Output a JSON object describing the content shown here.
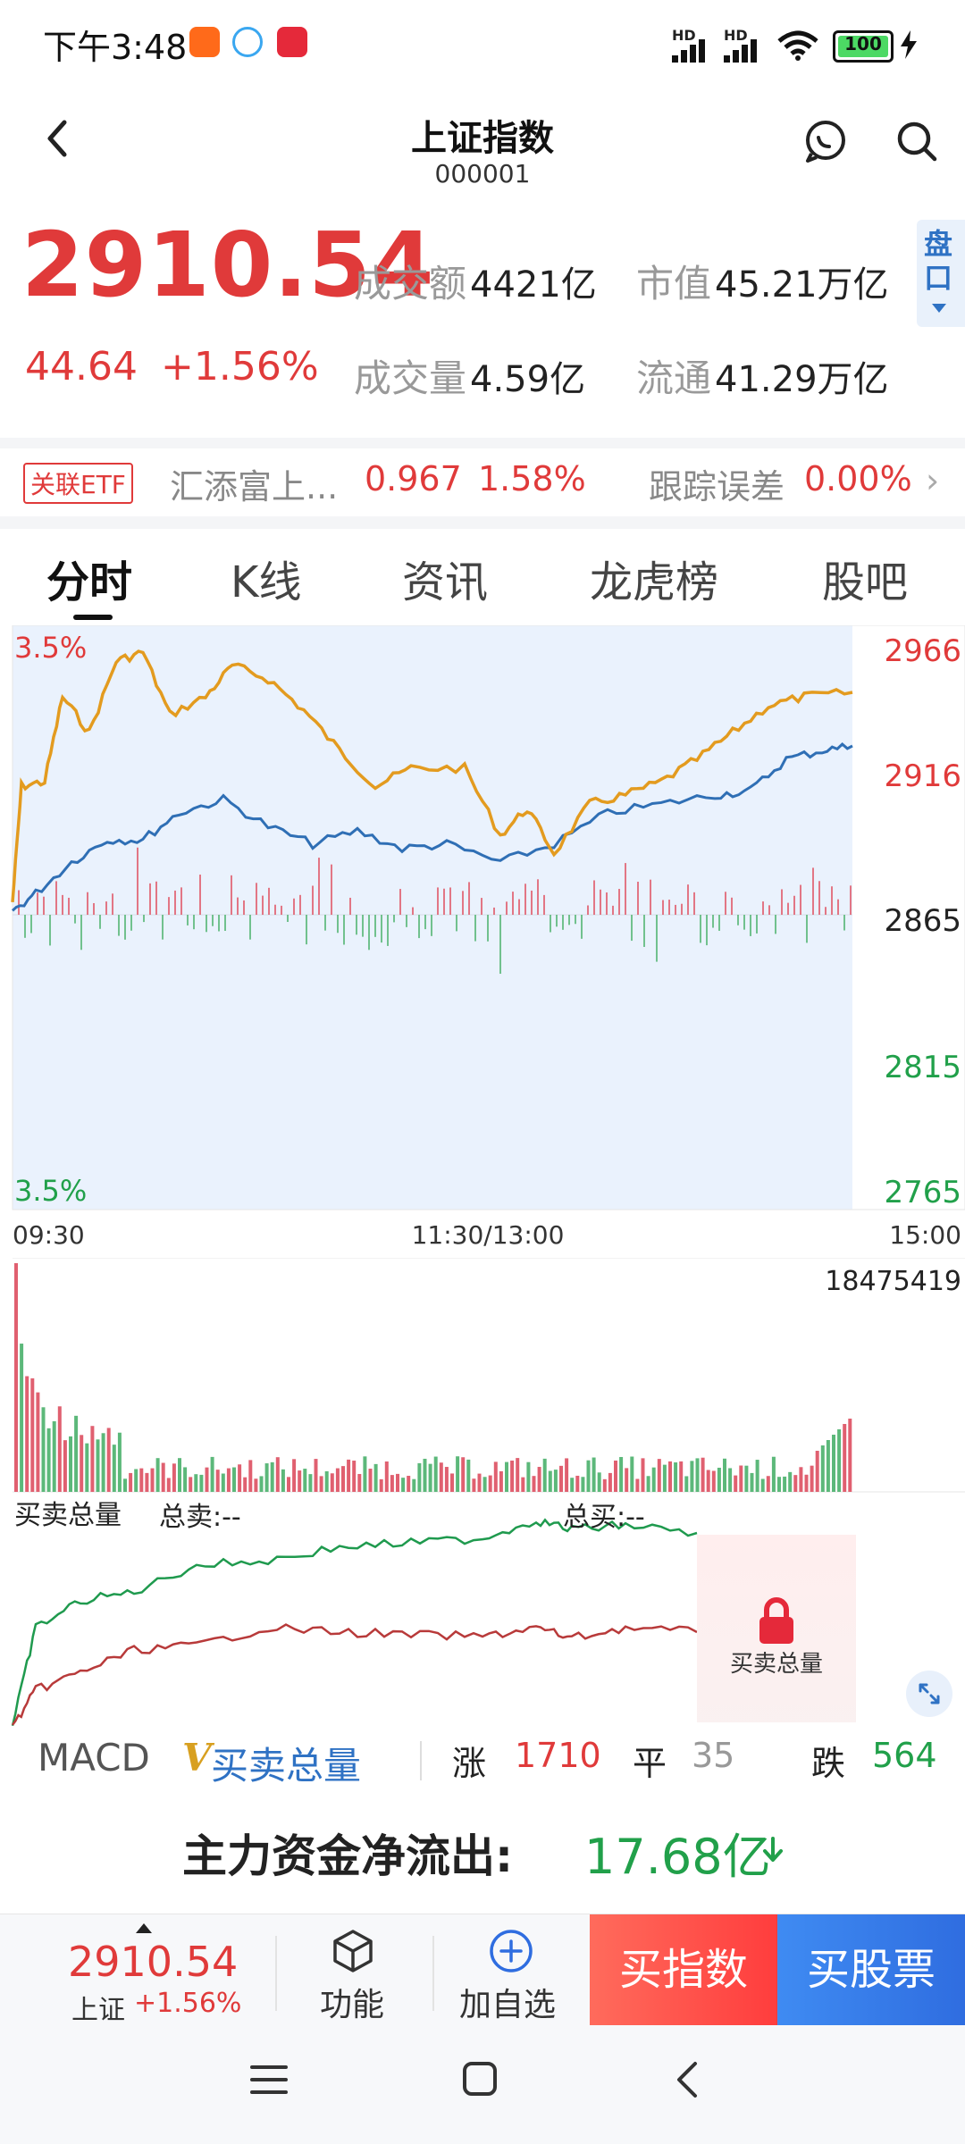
{
  "status_bar": {
    "time": "下午3:48",
    "signal_1": "HD",
    "signal_2": "HD",
    "battery": "100"
  },
  "header": {
    "title": "上证指数",
    "code": "000001"
  },
  "quote": {
    "price": "2910.54",
    "change": "44.64",
    "change_pct": "+1.56%",
    "turnover_label": "成交额",
    "turnover_value": "4421亿",
    "market_cap_label": "市值",
    "market_cap_value": "45.21万亿",
    "volume_label": "成交量",
    "volume_value": "4.59亿",
    "float_label": "流通",
    "float_value": "41.29万亿",
    "side_tab": "盘口"
  },
  "etf": {
    "badge": "关联ETF",
    "name": "汇添富上...",
    "price": "0.967",
    "pct": "1.58%",
    "tracking_label": "跟踪误差",
    "tracking_value": "0.00%"
  },
  "tabs": [
    {
      "label": "分时"
    },
    {
      "label": "K线"
    },
    {
      "label": "资讯"
    },
    {
      "label": "龙虎榜"
    },
    {
      "label": "股吧"
    }
  ],
  "intraday": {
    "top_pct": "3.5%",
    "bottom_pct": "3.5%",
    "y_labels": [
      "2966",
      "2916",
      "2865",
      "2815",
      "2765"
    ],
    "x_labels": [
      "09:30",
      "11:30/13:00",
      "15:00"
    ],
    "colors": {
      "price": "#e39b1f",
      "avg": "#2f6fb5",
      "fill": "#eaf2fd",
      "up": "#e03a3a",
      "down": "#21a04a"
    }
  },
  "volume": {
    "max_label": "18475419"
  },
  "buysell": {
    "title": "买卖总量",
    "sell_label": "总卖:--",
    "buy_label": "总买:--",
    "lock_label": "买卖总量"
  },
  "indicators": {
    "macd": "MACD",
    "v_mark": "V",
    "active": "买卖总量",
    "up_label": "涨",
    "up_value": "1710",
    "flat_label": "平",
    "flat_value": "35",
    "down_label": "跌",
    "down_value": "564"
  },
  "fund_flow": {
    "label": "主力资金净流出:",
    "value": "17.68亿"
  },
  "bottom_bar": {
    "price": "2910.54",
    "name": "上证",
    "pct": "+1.56%",
    "function_label": "功能",
    "add_label": "加自选",
    "buy_index": "买指数",
    "buy_stock": "买股票"
  }
}
